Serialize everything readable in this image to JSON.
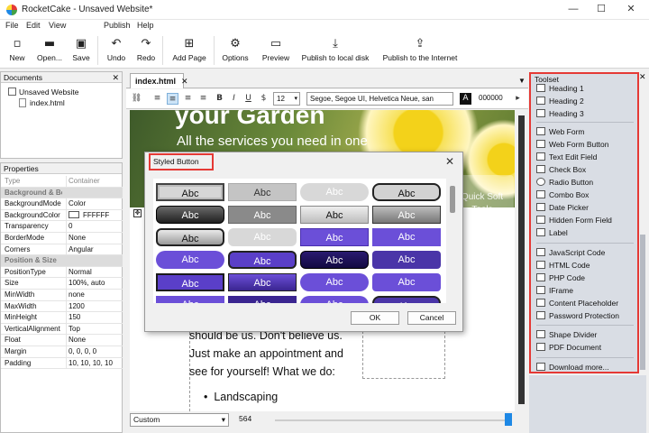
{
  "window": {
    "title": "RocketCake - Unsaved Website*",
    "minimize": "—",
    "maximize": "☐",
    "close": "✕"
  },
  "menu": [
    "File",
    "Edit",
    "View",
    "Publish",
    "Help"
  ],
  "toolbar": {
    "new": "New",
    "open": "Open...",
    "save": "Save",
    "undo": "Undo",
    "redo": "Redo",
    "add_page": "Add Page",
    "options": "Options",
    "preview": "Preview",
    "publish_local": "Publish to local disk",
    "publish_internet": "Publish to the Internet"
  },
  "documents": {
    "header": "Documents",
    "close": "✕",
    "root": "Unsaved Website",
    "file": "index.html"
  },
  "properties": {
    "header": "Properties",
    "rows": [
      {
        "k": "Type",
        "v": "Container",
        "style": "dim"
      },
      {
        "k": "Background & Border",
        "v": "",
        "style": "sec"
      },
      {
        "k": "BackgroundMode",
        "v": "Color",
        "style": ""
      },
      {
        "k": "BackgroundColor",
        "v": "FFFFFF",
        "style": ""
      },
      {
        "k": "Transparency",
        "v": "0",
        "style": ""
      },
      {
        "k": "BorderMode",
        "v": "None",
        "style": ""
      },
      {
        "k": "Corners",
        "v": "Angular",
        "style": ""
      },
      {
        "k": "Position & Size",
        "v": "",
        "style": "sec"
      },
      {
        "k": "PositionType",
        "v": "Normal",
        "style": ""
      },
      {
        "k": "Size",
        "v": "100%, auto",
        "style": ""
      },
      {
        "k": "MinWidth",
        "v": "none",
        "style": ""
      },
      {
        "k": "MaxWidth",
        "v": "1200",
        "style": ""
      },
      {
        "k": "MinHeight",
        "v": "150",
        "style": ""
      },
      {
        "k": "VerticalAlignment",
        "v": "Top",
        "style": ""
      },
      {
        "k": "Float",
        "v": "None",
        "style": ""
      },
      {
        "k": "Margin",
        "v": "0, 0, 0, 0",
        "style": ""
      },
      {
        "k": "Padding",
        "v": "10, 10, 10, 10",
        "style": ""
      }
    ]
  },
  "editor": {
    "tab": "index.html",
    "font_size": "12",
    "font_family": "Segoe, Segoe UI, Helvetica Neue, san",
    "color": "000000",
    "hero_title": "your Garden",
    "hero_sub": "All the services you need in one",
    "body_lines": [
      "should be us. Don't believe us.",
      "Just make an appointment and",
      "see for yourself! What we do:"
    ],
    "bullet": "Landscaping",
    "zoom_mode": "Custom",
    "width": "564",
    "watermark": "Quick Soft Tools"
  },
  "dialog": {
    "title": "Styled Button",
    "close": "✕",
    "button_text": "Abc",
    "ok": "OK",
    "cancel": "Cancel"
  },
  "toolset": {
    "header": "Toolset",
    "close": "✕",
    "items": [
      "Heading 1",
      "Heading 2",
      "Heading 3",
      "Web Form",
      "Web Form Button",
      "Text Edit Field",
      "Check Box",
      "Radio Button",
      "Combo Box",
      "Date Picker",
      "Hidden Form Field",
      "Label",
      "JavaScript Code",
      "HTML Code",
      "PHP Code",
      "IFrame",
      "Content Placeholder",
      "Password Protection",
      "Shape Divider",
      "PDF Document",
      "Download more..."
    ]
  },
  "colors": {
    "accent_red": "#e53935",
    "purple": "#6b4fd8",
    "toolset_bg": "#d9dde4"
  }
}
